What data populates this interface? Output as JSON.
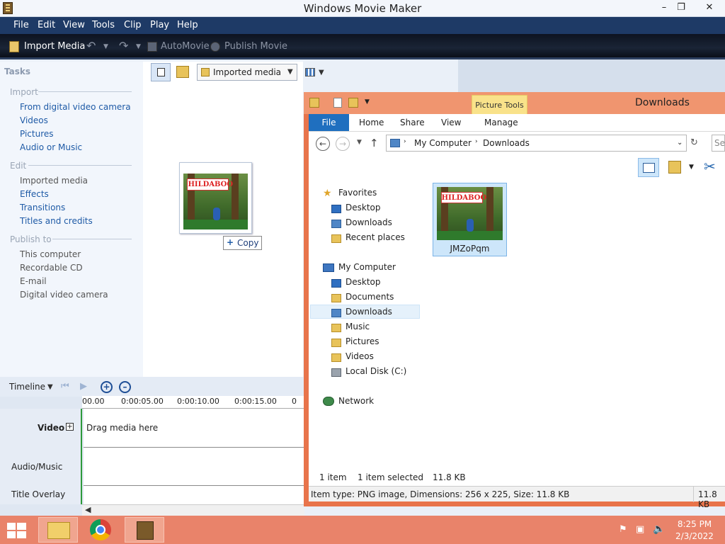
{
  "movie_maker": {
    "title": "Windows Movie Maker",
    "menu": [
      "File",
      "Edit",
      "View",
      "Tools",
      "Clip",
      "Play",
      "Help"
    ],
    "toolbar": {
      "import_media": "Import Media",
      "automovie": "AutoMovie",
      "publish_movie": "Publish Movie"
    },
    "tasks": {
      "heading": "Tasks",
      "import_title": "Import",
      "import_items": [
        "From digital video camera",
        "Videos",
        "Pictures",
        "Audio or Music"
      ],
      "edit_title": "Edit",
      "edit_items": [
        "Imported media",
        "Effects",
        "Transitions",
        "Titles and credits"
      ],
      "publish_title": "Publish to",
      "publish_items": [
        "This computer",
        "Recordable CD",
        "E-mail",
        "Digital video camera"
      ]
    },
    "collection": {
      "selected": "Imported media",
      "drag_tooltip": "Copy"
    },
    "timeline": {
      "label": "Timeline",
      "ticks": [
        "00.00",
        "0:00:05.00",
        "0:00:10.00",
        "0:00:15.00",
        "0"
      ],
      "tracks": [
        "Video",
        "Audio/Music",
        "Title Overlay"
      ],
      "expand_symbol": "+",
      "drag_hint": "Drag media here"
    }
  },
  "explorer": {
    "title": "Downloads",
    "contextual_tab": "Picture Tools",
    "tabs": [
      "File",
      "Home",
      "Share",
      "View",
      "Manage"
    ],
    "breadcrumb": [
      "My Computer",
      "Downloads"
    ],
    "search_placeholder": "Se",
    "nav": {
      "favorites": "Favorites",
      "favorites_items": [
        "Desktop",
        "Downloads",
        "Recent places"
      ],
      "computer": "My Computer",
      "computer_items": [
        "Desktop",
        "Documents",
        "Downloads",
        "Music",
        "Pictures",
        "Videos",
        "Local Disk (C:)"
      ],
      "network": "Network"
    },
    "file": {
      "name": "JMZoPqm",
      "thumb_text": "HILDABOO"
    },
    "status": {
      "count": "1 item",
      "selected": "1 item selected",
      "size": "11.8 KB"
    },
    "details": {
      "text": "Item type: PNG image, Dimensions: 256 x 225, Size: 11.8 KB",
      "size": "11.8 KB"
    }
  },
  "taskbar": {
    "time": "8:25 PM",
    "date": "2/3/2022"
  },
  "colors": {
    "menubar": "#1e3a66",
    "explorer_frame": "#e8744b",
    "taskbar": "#e9836a",
    "link_blue": "#1e5aa6"
  }
}
